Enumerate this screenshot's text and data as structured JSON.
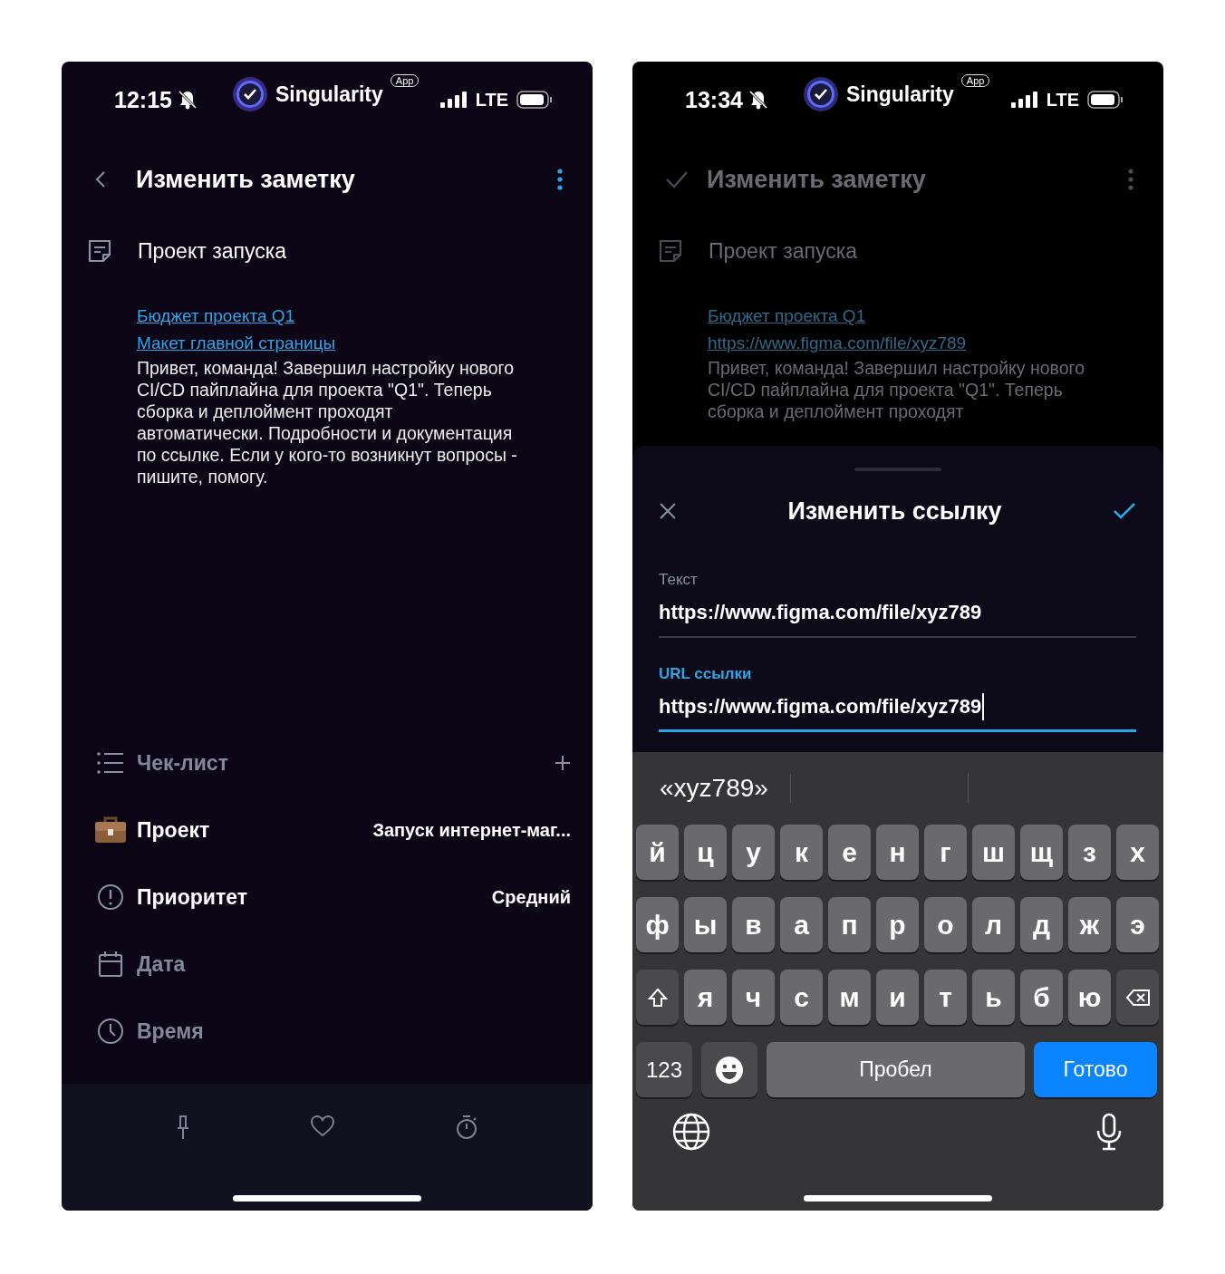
{
  "left_screen": {
    "status_bar": {
      "time": "12:15",
      "app_name": "Singularity",
      "app_badge": "App",
      "network": "LTE"
    },
    "header": {
      "kind": "back",
      "title": "Изменить заметку"
    },
    "note": {
      "title": "Проект запуска",
      "links": [
        "Бюджет проекта Q1",
        "Макет главной страницы"
      ],
      "body_lines": [
        "Привет, команда! Завершил настройку нового",
        "CI/CD пайплайна для проекта \"Q1\". Теперь",
        "сборка и деплоймент проходят",
        "автоматически. Подробности и документация",
        "по ссылке. Если у кого-то возникнут вопросы -",
        "пишите, помогу."
      ]
    },
    "properties": [
      {
        "kind": "checklist",
        "label": "Чек-лист",
        "set": false
      },
      {
        "kind": "project",
        "label": "Проект",
        "set": true,
        "value": "Запуск интернет-маг..."
      },
      {
        "kind": "priority",
        "label": "Приоритет",
        "set": true,
        "value": "Средний"
      },
      {
        "kind": "date",
        "label": "Дата",
        "set": false
      },
      {
        "kind": "time",
        "label": "Время",
        "set": false
      }
    ],
    "bottom_bar": [
      {
        "kind": "pin"
      },
      {
        "kind": "favorite"
      },
      {
        "kind": "timer"
      }
    ]
  },
  "right_screen": {
    "status_bar": {
      "time": "13:34",
      "app_name": "Singularity",
      "app_badge": "App",
      "network": "LTE"
    },
    "background": {
      "header": {
        "kind": "check",
        "title": "Изменить заметку"
      },
      "note": {
        "title": "Проект запуска",
        "links": [
          "Бюджет проекта Q1",
          "https://www.figma.com/file/xyz789"
        ],
        "body_lines": [
          "Привет, команда! Завершил настройку нового",
          "CI/CD пайплайна для проекта \"Q1\". Теперь",
          "сборка и деплоймент проходят"
        ]
      }
    },
    "sheet": {
      "title": "Изменить ссылку",
      "fields": [
        {
          "label": "Текст",
          "value": "https://www.figma.com/file/xyz789",
          "focused": false
        },
        {
          "label": "URL ссылки",
          "value": "https://www.figma.com/file/xyz789",
          "focused": true
        }
      ]
    },
    "keyboard": {
      "suggestions": [
        "«xyz789»"
      ],
      "top_row": [
        "й",
        "ц",
        "у",
        "к",
        "е",
        "н",
        "г",
        "ш",
        "щ",
        "з",
        "х"
      ],
      "middle_row": [
        "ф",
        "ы",
        "в",
        "а",
        "п",
        "р",
        "о",
        "л",
        "д",
        "ж",
        "э"
      ],
      "bottom_row": [
        "я",
        "ч",
        "с",
        "м",
        "и",
        "т",
        "ь",
        "б",
        "ю"
      ],
      "numbers_key": "123",
      "space_key": "Пробел",
      "done_key": "Готово"
    }
  }
}
